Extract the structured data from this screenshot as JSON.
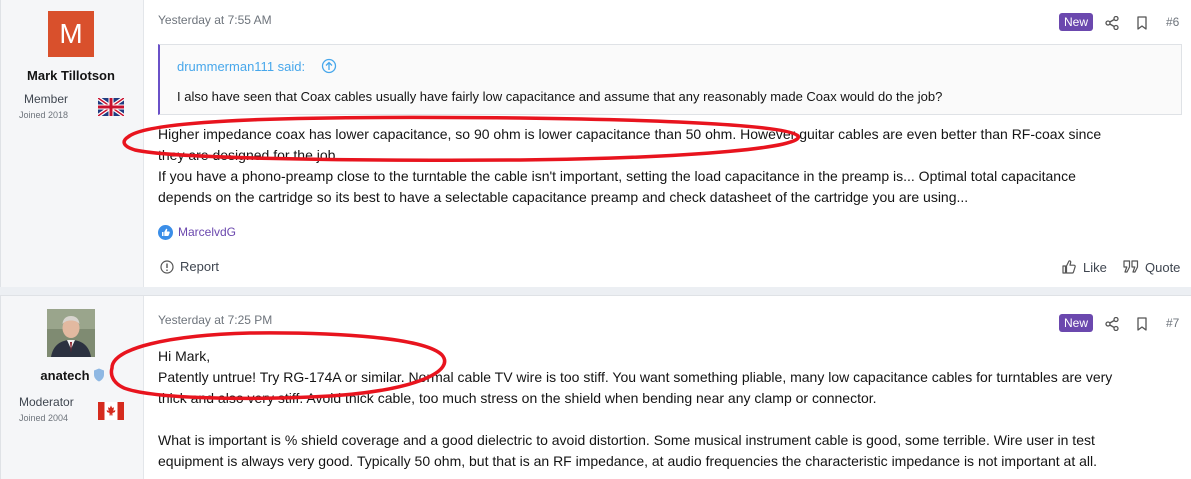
{
  "posts": [
    {
      "author": {
        "name": "Mark Tillotson",
        "avatar_letter": "M",
        "avatar_color": "#d9502c",
        "role": "Member",
        "joined": "Joined 2018",
        "flag": "uk-flag-icon"
      },
      "date": "Yesterday at 7:55 AM",
      "badge": "New",
      "number": "#6",
      "quote": {
        "author": "drummerman111 said:",
        "text": "I also have seen that Coax cables usually have fairly low capacitance and assume that any reasonably made Coax would do the job?"
      },
      "lines": [
        "Higher impedance coax has lower capacitance, so 90 ohm is lower capacitance than 50 ohm. However guitar cables are even better than RF-coax since",
        "they are designed for the job.",
        "If you have a phono-preamp close to the turntable the cable isn't important, setting the load capacitance in the preamp is... Optimal total capacitance",
        "depends on the cartridge so its best to have a selectable capacitance preamp and check datasheet of the cartridge you are using..."
      ],
      "reaction_user": "MarcelvdG",
      "report_label": "Report",
      "like_label": "Like",
      "quote_label": "Quote"
    },
    {
      "author": {
        "name": "anatech",
        "role": "Moderator",
        "joined": "Joined 2004",
        "flag": "canada-flag-icon"
      },
      "date": "Yesterday at 7:25 PM",
      "badge": "New",
      "number": "#7",
      "lines": [
        "Hi Mark,",
        "Patently untrue! Try RG-174A or similar. Normal cable TV wire is too stiff. You want something pliable, many low capacitance cables for turntables are very",
        "thick and also very stiff. Avoid thick cable, too much stress on the shield when bending near any clamp or connector.",
        "",
        "What is important is % shield coverage and a good dielectric to avoid distortion. Some musical instrument cable is good, some terrible. Wire user in test",
        "equipment is always very good. Typically 50 ohm, but that is an RF impedance, at audio frequencies the characteristic impedance is not important at all."
      ]
    }
  ],
  "colors": {
    "badge": "#6b48ae",
    "link": "#47a7eb",
    "annotation": "#e8141e"
  }
}
